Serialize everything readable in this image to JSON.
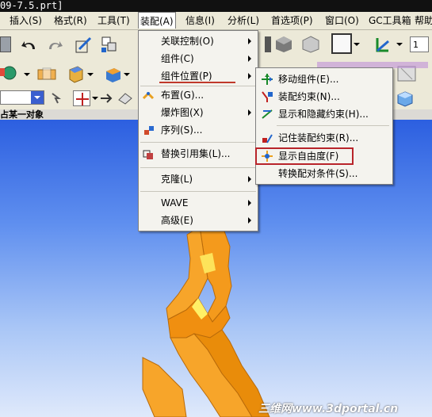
{
  "window": {
    "title": "09-7.5.prt]"
  },
  "menubar": {
    "items": [
      {
        "label": "插入(S)"
      },
      {
        "label": "格式(R)"
      },
      {
        "label": "工具(T)"
      },
      {
        "label": "装配(A)"
      },
      {
        "label": "信息(I)"
      },
      {
        "label": "分析(L)"
      },
      {
        "label": "首选项(P)"
      },
      {
        "label": "窗口(O)"
      },
      {
        "label": "GC工具箱"
      },
      {
        "label": "帮助"
      }
    ]
  },
  "toolbar": {
    "zoom_value": "1"
  },
  "selection_bar": {
    "label": "占某一对象"
  },
  "assembly_menu": {
    "items": [
      {
        "label": "关联控制(O)",
        "submenu": true
      },
      {
        "label": "组件(C)",
        "submenu": true
      },
      {
        "label": "组件位置(P)",
        "submenu": true
      },
      {
        "label": "布置(G)..."
      },
      {
        "label": "爆炸图(X)",
        "submenu": true
      },
      {
        "label": "序列(S)..."
      },
      {
        "label": "替换引用集(L)..."
      },
      {
        "label": "克隆(L)",
        "submenu": true
      },
      {
        "label": "WAVE",
        "submenu": true
      },
      {
        "label": "高级(E)",
        "submenu": true
      }
    ]
  },
  "component_position_menu": {
    "items": [
      {
        "label": "移动组件(E)..."
      },
      {
        "label": "装配约束(N)..."
      },
      {
        "label": "显示和隐藏约束(H)..."
      },
      {
        "label": "记住装配约束(R)..."
      },
      {
        "label": "显示自由度(F)"
      },
      {
        "label": "转换配对条件(S)..."
      }
    ]
  },
  "watermark": {
    "text": "三维网www.3dportal.cn"
  },
  "colors": {
    "accent_red": "#c0392b",
    "part_orange": "#f7941d",
    "canvas_blue": "#2c5fe0"
  }
}
